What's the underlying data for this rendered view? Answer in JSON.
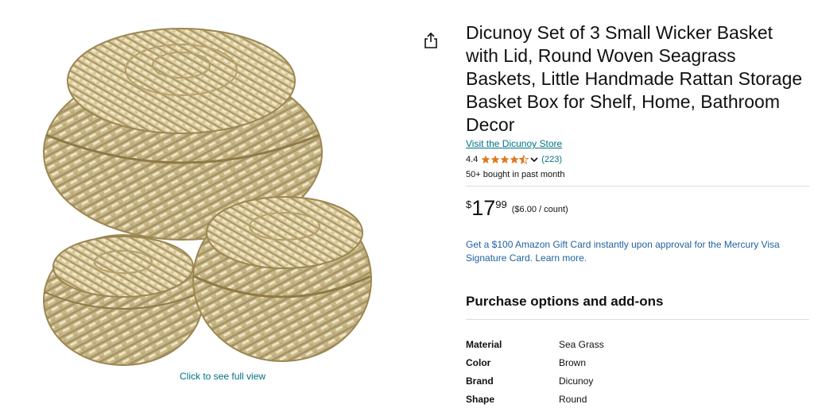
{
  "product": {
    "title": "Dicunoy Set of 3 Small Wicker Basket with Lid, Round Woven Seagrass Baskets, Little Handmade Rattan Storage Basket Box for Shelf, Home, Bathroom Decor",
    "store_link": "Visit the Dicunoy Store",
    "rating": "4.4",
    "stars": 4.4,
    "review_count": "(223)",
    "bought": "50+ bought in past month"
  },
  "price": {
    "symbol": "$",
    "whole": "17",
    "fraction": "99",
    "per_unit": "($6.00 / count)"
  },
  "promo": {
    "text": "Get a $100 Amazon Gift Card instantly upon approval for the Mercury Visa Signature Card. Learn more."
  },
  "purchase_options": {
    "title": "Purchase options and add-ons"
  },
  "specs": [
    {
      "key": "Material",
      "value": "Sea Grass"
    },
    {
      "key": "Color",
      "value": "Brown"
    },
    {
      "key": "Brand",
      "value": "Dicunoy"
    },
    {
      "key": "Shape",
      "value": "Round"
    }
  ],
  "image": {
    "hint": "Click to see full view"
  },
  "icons": {
    "share": "share-icon",
    "star": "star-icon",
    "chevron": "chevron-down-icon"
  },
  "colors": {
    "link": "#007185",
    "promo_link": "#2162a1",
    "star": "#de7921",
    "text": "#0f1111",
    "basket_light": "#e8dbb4",
    "basket_dark": "#a08a57"
  }
}
